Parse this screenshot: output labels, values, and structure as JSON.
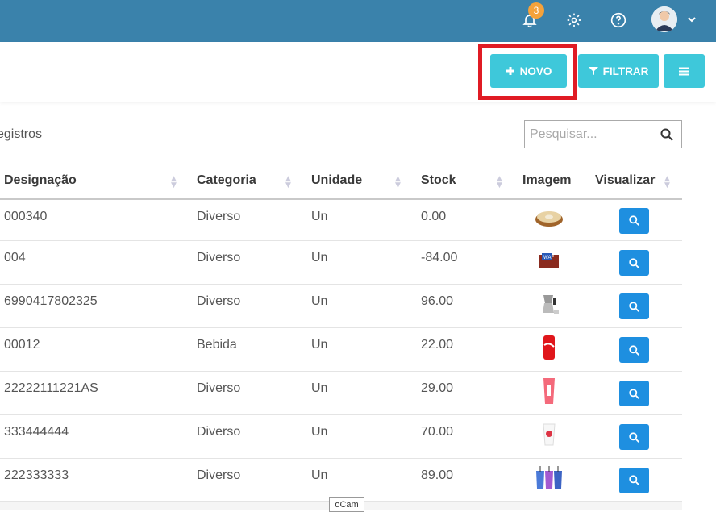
{
  "topbar": {
    "notifications_count": "3",
    "icons": [
      "bell-icon",
      "gear-icon",
      "help-icon",
      "avatar",
      "chevron-down-icon"
    ]
  },
  "actions": {
    "novo_label": "NOVO",
    "filtrar_label": "FILTRAR"
  },
  "records_label": "egistros",
  "search": {
    "placeholder": "Pesquisar..."
  },
  "table": {
    "headers": [
      "Designação",
      "Categoria",
      "Unidade",
      "Stock",
      "Imagem",
      "Visualizar"
    ],
    "rows": [
      {
        "designacao": "000340",
        "categoria": "Diverso",
        "unidade": "Un",
        "stock": "0.00",
        "image": "bagel"
      },
      {
        "designacao": "004",
        "categoria": "Diverso",
        "unidade": "Un",
        "stock": "-84.00",
        "image": "snack-box"
      },
      {
        "designacao": "6990417802325",
        "categoria": "Diverso",
        "unidade": "Un",
        "stock": "96.00",
        "image": "coffee-maker"
      },
      {
        "designacao": "00012",
        "categoria": "Bebida",
        "unidade": "Un",
        "stock": "22.00",
        "image": "soda-can"
      },
      {
        "designacao": "22222111221AS",
        "categoria": "Diverso",
        "unidade": "Un",
        "stock": "29.00",
        "image": "pink-cup"
      },
      {
        "designacao": "333444444",
        "categoria": "Diverso",
        "unidade": "Un",
        "stock": "70.00",
        "image": "plastic-cup"
      },
      {
        "designacao": "222333333",
        "categoria": "Diverso",
        "unidade": "Un",
        "stock": "89.00",
        "image": "tumblers"
      }
    ]
  },
  "overlay_label": "oCam",
  "colors": {
    "topbar": "#3a82ab",
    "accent_button": "#3ec8da",
    "view_button": "#1e8fe0",
    "badge": "#f4a23b",
    "highlight": "#e01b24"
  }
}
